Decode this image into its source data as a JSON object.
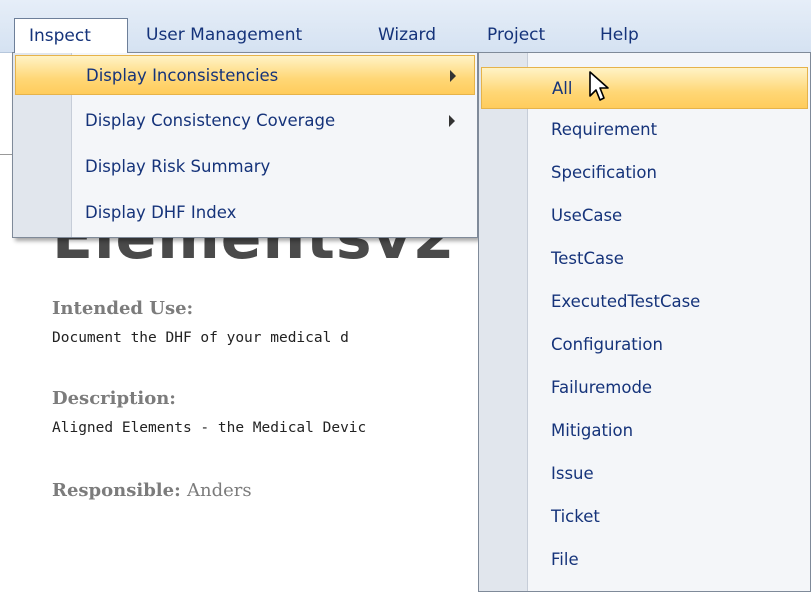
{
  "menubar": {
    "items": [
      "Inspect",
      "User Management",
      "Wizard",
      "Project",
      "Help"
    ]
  },
  "inspect_menu": {
    "items": [
      {
        "label": "Display Inconsistencies",
        "has_submenu": true
      },
      {
        "label": "Display Consistency Coverage",
        "has_submenu": true
      },
      {
        "label": "Display Risk Summary",
        "has_submenu": false
      },
      {
        "label": "Display DHF Index",
        "has_submenu": false
      }
    ]
  },
  "submenu": {
    "items": [
      "All",
      "Requirement",
      "Specification",
      "UseCase",
      "TestCase",
      "ExecutedTestCase",
      "Configuration",
      "Failuremode",
      "Mitigation",
      "Issue",
      "Ticket",
      "File"
    ]
  },
  "document": {
    "title": "Elementsv2",
    "intended_use_label": "Intended Use:",
    "intended_use_text": "Document the DHF of your medical d",
    "description_label": "Description:",
    "description_text": "Aligned Elements - the Medical Devic",
    "responsible_label": "Responsible:",
    "responsible_value": "Anders"
  },
  "colors": {
    "menu_text": "#15337a",
    "highlight": "#ffd776",
    "menubar_bg": "#dce6f3"
  }
}
